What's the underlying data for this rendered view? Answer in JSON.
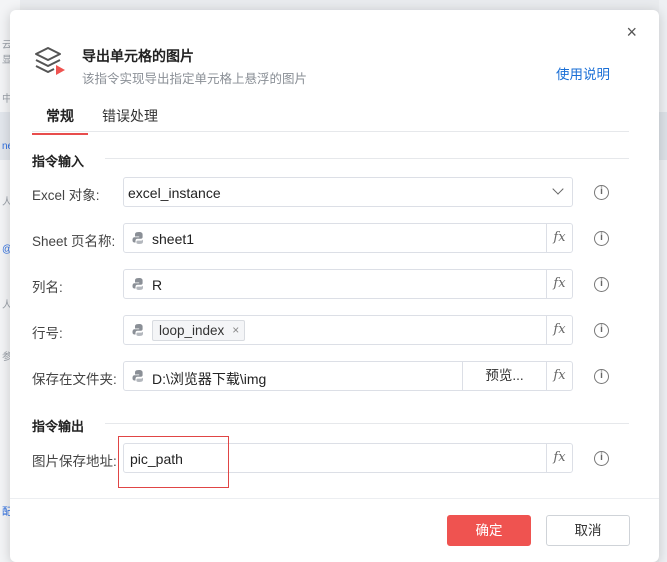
{
  "background": {
    "glyphs": [
      "云显",
      "中",
      "ne",
      "人",
      "@i",
      "人",
      "参",
      "配"
    ]
  },
  "dialog": {
    "title": "导出单元格的图片",
    "subtitle": "该指令实现导出指定单元格上悬浮的图片",
    "help_link": "使用说明",
    "close_icon": "×",
    "tabs": [
      {
        "label": "常规",
        "active": true
      },
      {
        "label": "错误处理",
        "active": false
      }
    ],
    "input_section": "指令输入",
    "output_section": "指令输出",
    "fields": {
      "excel": {
        "label": "Excel 对象:",
        "value": "excel_instance"
      },
      "sheet": {
        "label": "Sheet 页名称:",
        "value": "sheet1"
      },
      "column": {
        "label": "列名:",
        "value": "R"
      },
      "row": {
        "label": "行号:",
        "tag": "loop_index",
        "tag_close": "×"
      },
      "folder": {
        "label": "保存在文件夹:",
        "value": "D:\\浏览器下载\\img",
        "browse_label": "预览..."
      },
      "pic_path": {
        "label": "图片保存地址:",
        "value": "pic_path"
      }
    },
    "fx_label": "fx",
    "info_label": "i",
    "buttons": {
      "ok": "确定",
      "cancel": "取消"
    },
    "colors": {
      "accent": "#ef5350",
      "link": "#1a6fd6",
      "highlight_box": "#e04545"
    }
  }
}
